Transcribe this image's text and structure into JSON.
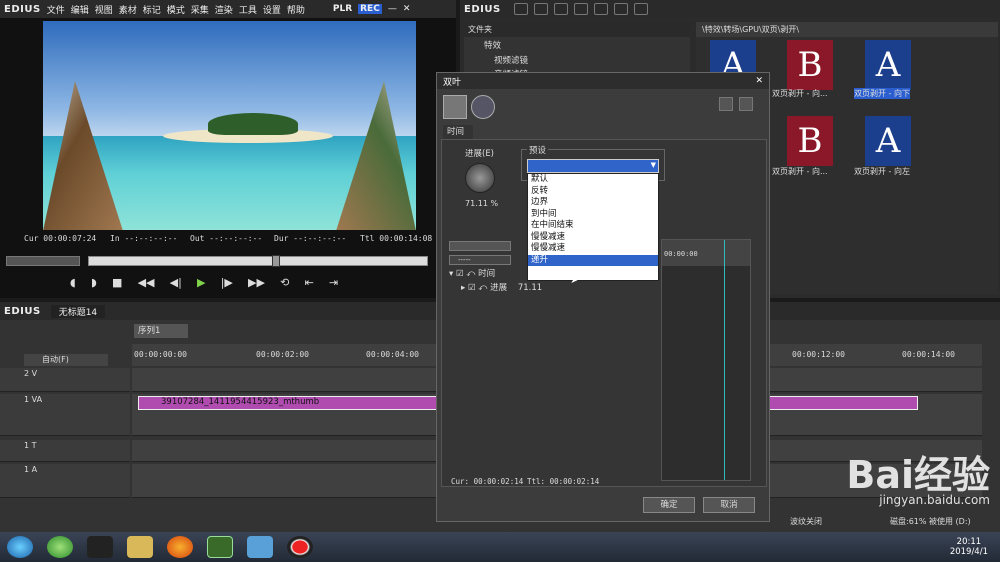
{
  "player": {
    "brand": "EDIUS",
    "menu": [
      "文件",
      "编辑",
      "视图",
      "素材",
      "标记",
      "模式",
      "采集",
      "渲染",
      "工具",
      "设置",
      "帮助"
    ],
    "plr": "PLR",
    "rec": "REC",
    "cur": "Cur 00:00:07:24",
    "in": "In --:--:--:--",
    "out": "Out --:--:--:--",
    "dur": "Dur --:--:--:--",
    "ttl": "Ttl 00:00:14:08"
  },
  "bin": {
    "brand": "EDIUS",
    "folder_header": "文件夹",
    "tree": [
      "特效",
      "视频滤镜",
      "音频滤镜"
    ],
    "path": "\\特效\\转场\\GPU\\双页\\剥开\\",
    "items": [
      {
        "label": "双页剥开 - 向...",
        "letter": "A"
      },
      {
        "label": "",
        "letter": "B"
      },
      {
        "label": "双页剥开 - 向下",
        "letter": "A"
      },
      {
        "label": "双页剥开 - 向...",
        "letter": "B"
      },
      {
        "label": "双页剥开 - 向左",
        "letter": "A"
      }
    ]
  },
  "dialog": {
    "title": "双叶",
    "tab": "时间",
    "progress_label": "进展(E)",
    "progress_value": "71.11 %",
    "preset_label": "预设",
    "presets": [
      "默认",
      "反转",
      "边界",
      "到中间",
      "在中间结束",
      "慢慢减速",
      "慢慢减速",
      "递升"
    ],
    "selected": 7,
    "tree_time": "时间",
    "tree_progress": "进展",
    "tree_progress_val": "71.11",
    "zoom": "-----",
    "ruler": "00:00:00",
    "cur": "Cur: 00:00:02:14",
    "ttl": "Ttl: 00:00:02:14",
    "ok": "确定",
    "cancel": "取消"
  },
  "timeline": {
    "brand": "EDIUS",
    "project": "无标题14",
    "sequence": "序列1",
    "track_mode": "自动(F)",
    "ruler": [
      "00:00:00:00",
      "00:00:02:00",
      "00:00:04:00",
      "00:00:12:00",
      "00:00:14:00"
    ],
    "tracks": [
      "2 V",
      "1 VA",
      "1 T",
      "1 A"
    ],
    "clip": "39107284_1411954415923_mthumb",
    "status": "波纹关闭",
    "disk": "磁盘:61% 被使用 (D:)"
  },
  "taskbar": {
    "time": "20:11",
    "date": "2019/4/1"
  },
  "watermark": {
    "brand": "Bai经验",
    "url": "jingyan.baidu.com"
  }
}
